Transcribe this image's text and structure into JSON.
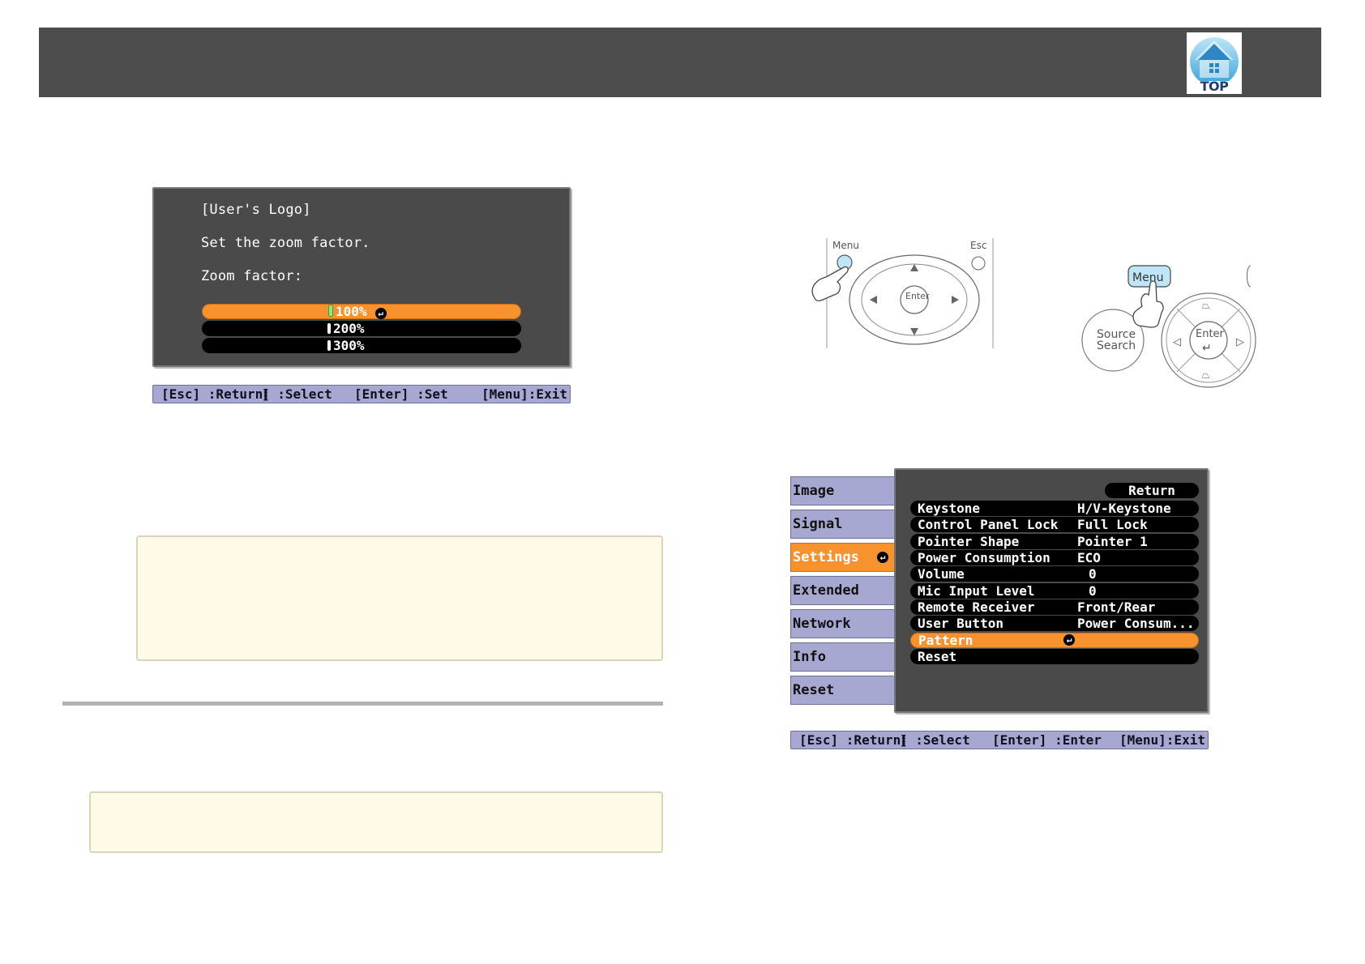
{
  "header": {
    "logo_label": "TOP"
  },
  "zoom_dialog": {
    "title": "[User's Logo]",
    "instruction": "Set the zoom factor.",
    "field_label": "Zoom factor:",
    "options": [
      {
        "label": "100%",
        "selected": true
      },
      {
        "label": "200%",
        "selected": false
      },
      {
        "label": "300%",
        "selected": false
      }
    ],
    "statusbar": {
      "esc": "[Esc] :Return",
      "select_prefix": "[",
      "select_suffix": "] :Select",
      "enter": "[Enter] :Set",
      "menu": "[Menu]:Exit"
    }
  },
  "remote": {
    "menu_label": "Menu",
    "esc_label": "Esc",
    "enter_label": "Enter"
  },
  "control_panel": {
    "menu_label": "Menu",
    "source_search_line1": "Source",
    "source_search_line2": "Search",
    "enter_label": "Enter"
  },
  "config_menu": {
    "tabs": [
      {
        "label": "Image"
      },
      {
        "label": "Signal"
      },
      {
        "label": "Settings",
        "selected": true
      },
      {
        "label": "Extended"
      },
      {
        "label": "Network"
      },
      {
        "label": "Info"
      },
      {
        "label": "Reset"
      }
    ],
    "return_label": "Return",
    "rows": [
      {
        "label": "Keystone",
        "value": "H/V-Keystone"
      },
      {
        "label": "Control Panel Lock",
        "value": "Full Lock"
      },
      {
        "label": "Pointer Shape",
        "value": "Pointer 1"
      },
      {
        "label": "Power Consumption",
        "value": "ECO"
      },
      {
        "label": "Volume",
        "value": "0"
      },
      {
        "label": "Mic Input Level",
        "value": "0"
      },
      {
        "label": "Remote Receiver",
        "value": "Front/Rear"
      },
      {
        "label": "User Button",
        "value": "Power Consum..."
      },
      {
        "label": "Pattern",
        "value": ""
      },
      {
        "label": "Reset",
        "value": ""
      }
    ],
    "statusbar": {
      "esc": "[Esc] :Return",
      "select_prefix": "[",
      "select_suffix": "] :Select",
      "enter": "[Enter] :Enter",
      "menu": "[Menu]:Exit"
    }
  },
  "colors": {
    "header": "#4d4d4d",
    "highlight": "#f7932f",
    "statusbar": "#a6a8d2",
    "note_fill": "#fffbe8"
  }
}
